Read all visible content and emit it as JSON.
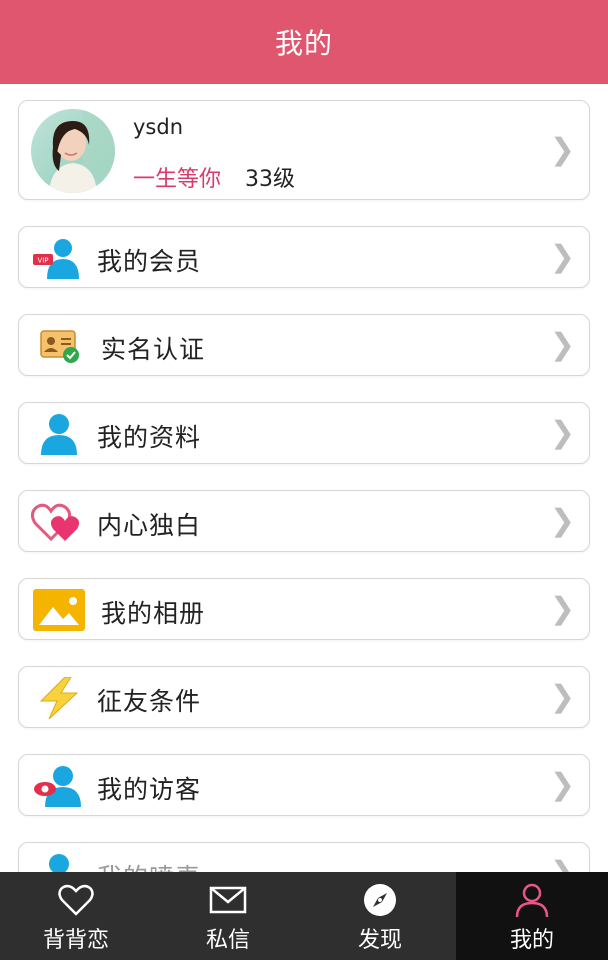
{
  "header": {
    "title": "我的"
  },
  "profile": {
    "username": "ysdn",
    "motto": "一生等你",
    "level": "33级"
  },
  "menu": [
    {
      "label": "我的会员",
      "icon": "vip-user-icon"
    },
    {
      "label": "实名认证",
      "icon": "id-verified-icon"
    },
    {
      "label": "我的资料",
      "icon": "user-profile-icon"
    },
    {
      "label": "内心独白",
      "icon": "hearts-icon"
    },
    {
      "label": "我的相册",
      "icon": "photo-album-icon"
    },
    {
      "label": "征友条件",
      "icon": "lightning-icon"
    },
    {
      "label": "我的访客",
      "icon": "visitor-eye-icon"
    },
    {
      "label": "我的喷麦",
      "icon": "user-profile-icon"
    }
  ],
  "tabs": [
    {
      "label": "背背恋",
      "icon": "heart-outline-icon"
    },
    {
      "label": "私信",
      "icon": "mail-icon"
    },
    {
      "label": "发现",
      "icon": "compass-icon"
    },
    {
      "label": "我的",
      "icon": "person-icon"
    }
  ],
  "colors": {
    "header": "#e0566f",
    "accent_pink": "#d83a6a",
    "tabbar": "#2f2f2f",
    "tab_active": "#111111",
    "icon_blue": "#1aa7e0"
  }
}
